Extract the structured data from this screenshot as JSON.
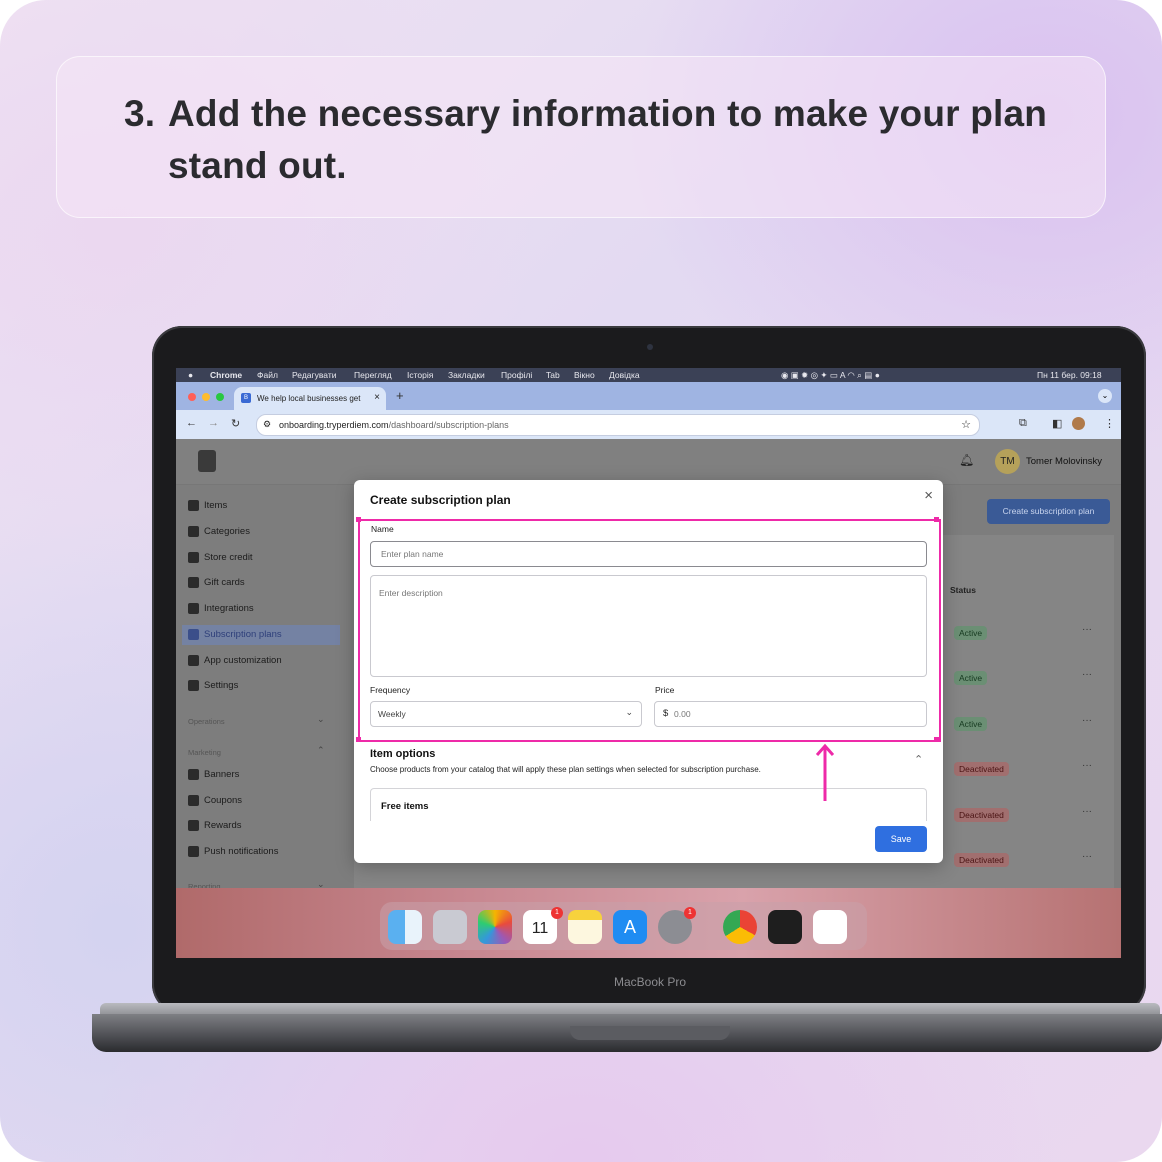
{
  "step": {
    "number": "3.",
    "text": "Add the necessary information to make your plan stand out."
  },
  "menubar": {
    "items": [
      "Chrome",
      "Файл",
      "Редагувати",
      "Перегляд",
      "Історія",
      "Закладки",
      "Профілі",
      "Tab",
      "Вікно",
      "Довідка"
    ],
    "clock": "Пн 11 бер. 09:18"
  },
  "browser": {
    "tab_title": "We help local businesses get",
    "url_host": "onboarding.tryperdiem.com",
    "url_path": "/dashboard/subscription-plans"
  },
  "app": {
    "user_initials": "TM",
    "user_name": "Tomer Molovinsky",
    "create_button": "Create subscription plan",
    "status_header": "Status",
    "sidebar": [
      {
        "label": "Items",
        "icon": "items-icon"
      },
      {
        "label": "Categories",
        "icon": "categories-icon"
      },
      {
        "label": "Store credit",
        "icon": "store-credit-icon"
      },
      {
        "label": "Gift cards",
        "icon": "gift-cards-icon"
      },
      {
        "label": "Integrations",
        "icon": "integrations-icon"
      },
      {
        "label": "Subscription plans",
        "icon": "subscription-plans-icon"
      },
      {
        "label": "App customization",
        "icon": "app-customization-icon"
      },
      {
        "label": "Settings",
        "icon": "settings-icon"
      }
    ],
    "sections": {
      "operations": "Operations",
      "marketing": "Marketing",
      "reporting": "Reporting"
    },
    "marketing_items": [
      {
        "label": "Banners",
        "icon": "banners-icon"
      },
      {
        "label": "Coupons",
        "icon": "coupons-icon"
      },
      {
        "label": "Rewards",
        "icon": "rewards-icon"
      },
      {
        "label": "Push notifications",
        "icon": "push-notifications-icon"
      }
    ],
    "statuses": [
      "Active",
      "Active",
      "Active",
      "Deactivated",
      "Deactivated",
      "Deactivated"
    ]
  },
  "modal": {
    "title": "Create subscription plan",
    "name_label": "Name",
    "name_placeholder": "Enter plan name",
    "description_placeholder": "Enter description",
    "frequency_label": "Frequency",
    "frequency_value": "Weekly",
    "price_label": "Price",
    "price_symbol": "$",
    "price_placeholder": "0.00",
    "item_options_title": "Item options",
    "item_options_desc": "Choose products from your catalog that will apply these plan settings when selected for subscription purchase.",
    "free_items": "Free items",
    "save_label": "Save"
  },
  "laptop_label": "MacBook Pro",
  "colors": {
    "highlight": "#ee2aa8",
    "primary": "#2f6fe0"
  }
}
